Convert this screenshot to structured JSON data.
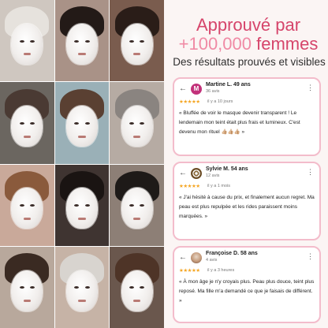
{
  "headline": {
    "line1": "Approuvé par",
    "line2_plus": "+100,000",
    "line2_rest": "femmes",
    "subtitle": "Des résultats prouvés et visibles"
  },
  "colors": {
    "accent": "#d6456b",
    "accent_light": "#f08aa5",
    "card_border": "#f3bccb",
    "stars": "#f5a623"
  },
  "photos": [
    {
      "bg": "#cfc7c0",
      "hair": "#e6e2dd"
    },
    {
      "bg": "#a99287",
      "hair": "#231a17"
    },
    {
      "bg": "#7a5c4e",
      "hair": "#2a1d18"
    },
    {
      "bg": "#6b6660",
      "hair": "#4a3a33"
    },
    {
      "bg": "#9ab0b7",
      "hair": "#5a4032"
    },
    {
      "bg": "#b6aba3",
      "hair": "#8a8480"
    },
    {
      "bg": "#c9a99a",
      "hair": "#8a5a3c"
    },
    {
      "bg": "#3f3431",
      "hair": "#1a1412"
    },
    {
      "bg": "#8d7f76",
      "hair": "#1e1a18"
    },
    {
      "bg": "#b8a89c",
      "hair": "#3a2a22"
    },
    {
      "bg": "#c6b3a6",
      "hair": "#d8d4cf"
    },
    {
      "bg": "#6a574d",
      "hair": "#4e3427"
    }
  ],
  "reviews": [
    {
      "back": "←",
      "more": "⋮",
      "avatar_letter": "M",
      "name": "Martine L. 49 ans",
      "meta": "36 avis",
      "stars": "★★★★★",
      "ago": "il y a 10 jours",
      "text": "« Bluffée de voir le masque devenir transparent ! Le lendemain mon teint était plus frais et lumineux. C'est devenu mon rituel 👍🏼👍🏼👍🏼 »"
    },
    {
      "back": "←",
      "more": "⋮",
      "name": "Sylvie M. 54 ans",
      "meta": "12 avis",
      "stars": "★★★★★",
      "ago": "il y a 1 mois",
      "text": "« J'ai hésité à cause du prix, et finalement aucun regret. Ma peau est plus repulpée et les rides paraissent moins marquées. »"
    },
    {
      "back": "←",
      "more": "⋮",
      "name": "Françoise D. 58 ans",
      "meta": "4 avis",
      "stars": "★★★★★",
      "ago": "il y a 3 heures",
      "text": "« À mon âge je n'y croyais plus. Peau plus douce, teint plus reposé. Ma fille m'a demandé ce que je faisais de différent. »"
    }
  ]
}
